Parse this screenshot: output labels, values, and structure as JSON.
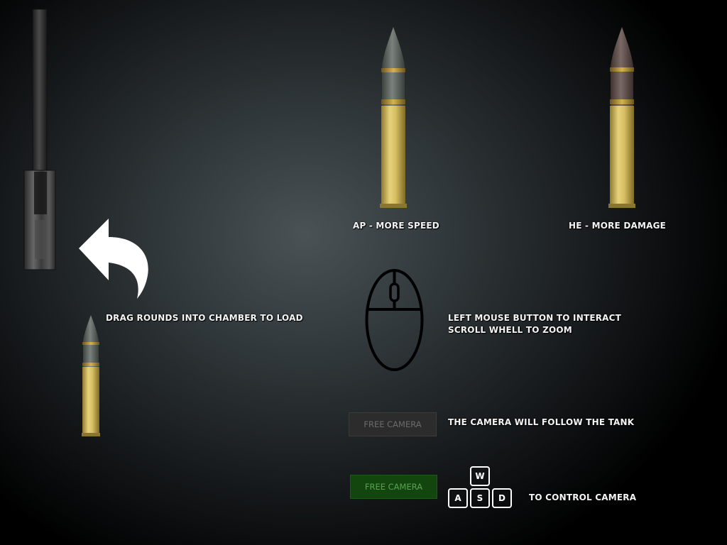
{
  "rounds": {
    "ap": {
      "label": "AP - MORE SPEED",
      "tip_color": "#5e6460"
    },
    "he": {
      "label": "HE - MORE DAMAGE",
      "tip_color": "#5b4a45"
    }
  },
  "load_hint": {
    "text": "DRAG ROUNDS INTO CHAMBER TO LOAD"
  },
  "mouse_hint": {
    "line1": "LEFT MOUSE BUTTON TO INTERACT",
    "line2": "SCROLL WHELL TO ZOOM"
  },
  "free_camera_off": {
    "button_label": "FREE CAMERA",
    "description": "THE CAMERA WILL FOLLOW THE TANK"
  },
  "free_camera_on": {
    "button_label": "FREE CAMERA",
    "description": "TO CONTROL CAMERA",
    "keys": [
      "W",
      "A",
      "S",
      "D"
    ]
  }
}
